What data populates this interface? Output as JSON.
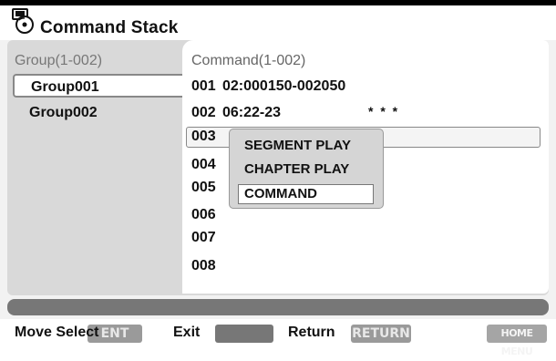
{
  "window": {
    "title": "Command Stack",
    "icon": "disc-icon"
  },
  "left_panel": {
    "header": "Group(1-002)",
    "groups": [
      {
        "label": "Group001",
        "selected": true
      },
      {
        "label": "Group002",
        "selected": false
      }
    ]
  },
  "right_panel": {
    "header": "Command(1-002)",
    "rows": [
      {
        "num": "001",
        "text": "02:000150-002050"
      },
      {
        "num": "002",
        "text": "06:22-23",
        "mark": "* * *"
      },
      {
        "num": "003",
        "text": ""
      },
      {
        "num": "004",
        "text": ""
      },
      {
        "num": "005",
        "text": ""
      },
      {
        "num": "006",
        "text": ""
      },
      {
        "num": "007",
        "text": ""
      },
      {
        "num": "008",
        "text": ""
      }
    ]
  },
  "popup_menu": {
    "items": [
      "SEGMENT PLAY",
      "CHAPTER PLAY",
      "COMMAND"
    ],
    "selected": "COMMAND"
  },
  "footer": {
    "move_select_label": "Move Select",
    "enter_key": "ENT",
    "exit_label": "Exit",
    "return_label": "Return",
    "return_key": "RETURN",
    "home_menu_key": "HOME MENU"
  }
}
